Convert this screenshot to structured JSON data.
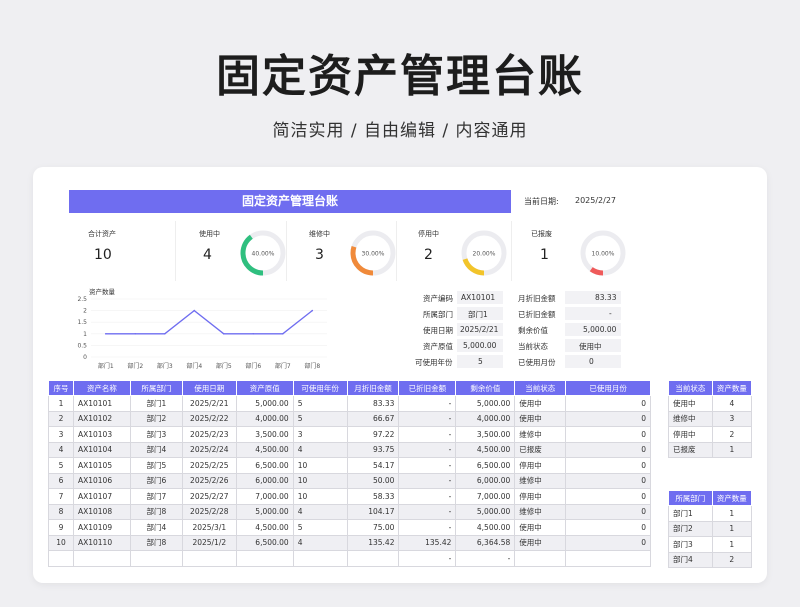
{
  "hero": {
    "title": "固定资产管理台账",
    "subtitle": "简洁实用 / 自由编辑 / 内容通用"
  },
  "sheet": {
    "title": "固定资产管理台账",
    "date_label": "当前日期:",
    "date_value": "2025/2/27"
  },
  "kpis": [
    {
      "label": "合计资产",
      "value": "10"
    },
    {
      "label": "使用中",
      "value": "4",
      "pct_label": "40.00%",
      "pct": 0.4,
      "color": "#2fbf7f"
    },
    {
      "label": "维修中",
      "value": "3",
      "pct_label": "30.00%",
      "pct": 0.3,
      "color": "#f08a3a"
    },
    {
      "label": "停用中",
      "value": "2",
      "pct_label": "20.00%",
      "pct": 0.2,
      "color": "#f2c42a"
    },
    {
      "label": "已报废",
      "value": "1",
      "pct_label": "10.00%",
      "pct": 0.1,
      "color": "#ef5a5a"
    }
  ],
  "chart_data": {
    "type": "line",
    "title": "资产数量",
    "categories": [
      "部门1",
      "部门2",
      "部门3",
      "部门4",
      "部门5",
      "部门6",
      "部门7",
      "部门8"
    ],
    "values": [
      1,
      1,
      1,
      2,
      1,
      1,
      1,
      2
    ],
    "ylim": [
      0,
      2.5
    ],
    "yticks": [
      "0",
      "0.5",
      "1",
      "1.5",
      "2",
      "2.5"
    ],
    "color": "#6f6df0"
  },
  "info": {
    "asset_code_label": "资产编码",
    "asset_code": "AX10101",
    "dept_label": "所属部门",
    "dept": "部门1",
    "use_date_label": "使用日期",
    "use_date": "2025/2/21",
    "orig_value_label": "资产原值",
    "orig_value": "5,000.00",
    "years_label": "可使用年份",
    "years": "5",
    "monthly_dep_label": "月折旧金额",
    "monthly_dep": "83.33",
    "done_dep_label": "已折旧金额",
    "done_dep": "-",
    "remain_label": "剩余价值",
    "remain": "5,000.00",
    "status_label": "当前状态",
    "status": "使用中",
    "used_months_label": "已使用月份",
    "used_months": "0"
  },
  "table": {
    "headers": [
      "序号",
      "资产名称",
      "所属部门",
      "使用日期",
      "资产原值",
      "可使用年份",
      "月折旧金额",
      "已折旧金额",
      "剩余价值",
      "当前状态",
      "已使用月份"
    ],
    "rows": [
      [
        "1",
        "AX10101",
        "部门1",
        "2025/2/21",
        "5,000.00",
        "5",
        "83.33",
        "-",
        "5,000.00",
        "使用中",
        "0"
      ],
      [
        "2",
        "AX10102",
        "部门2",
        "2025/2/22",
        "4,000.00",
        "5",
        "66.67",
        "-",
        "4,000.00",
        "使用中",
        "0"
      ],
      [
        "3",
        "AX10103",
        "部门3",
        "2025/2/23",
        "3,500.00",
        "3",
        "97.22",
        "-",
        "3,500.00",
        "维修中",
        "0"
      ],
      [
        "4",
        "AX10104",
        "部门4",
        "2025/2/24",
        "4,500.00",
        "4",
        "93.75",
        "-",
        "4,500.00",
        "已报废",
        "0"
      ],
      [
        "5",
        "AX10105",
        "部门5",
        "2025/2/25",
        "6,500.00",
        "10",
        "54.17",
        "-",
        "6,500.00",
        "停用中",
        "0"
      ],
      [
        "6",
        "AX10106",
        "部门6",
        "2025/2/26",
        "6,000.00",
        "10",
        "50.00",
        "-",
        "6,000.00",
        "维修中",
        "0"
      ],
      [
        "7",
        "AX10107",
        "部门7",
        "2025/2/27",
        "7,000.00",
        "10",
        "58.33",
        "-",
        "7,000.00",
        "停用中",
        "0"
      ],
      [
        "8",
        "AX10108",
        "部门8",
        "2025/2/28",
        "5,000.00",
        "4",
        "104.17",
        "-",
        "5,000.00",
        "维修中",
        "0"
      ],
      [
        "9",
        "AX10109",
        "部门4",
        "2025/3/1",
        "4,500.00",
        "5",
        "75.00",
        "-",
        "4,500.00",
        "使用中",
        "0"
      ],
      [
        "10",
        "AX10110",
        "部门8",
        "2025/1/2",
        "6,500.00",
        "4",
        "135.42",
        "135.42",
        "6,364.58",
        "使用中",
        "0"
      ],
      [
        "",
        "",
        "",
        "",
        "",
        "",
        "",
        "-",
        "-",
        "",
        ""
      ]
    ]
  },
  "status_table": {
    "headers": [
      "当前状态",
      "资产数量"
    ],
    "rows": [
      [
        "使用中",
        "4"
      ],
      [
        "维修中",
        "3"
      ],
      [
        "停用中",
        "2"
      ],
      [
        "已报废",
        "1"
      ]
    ]
  },
  "dept_table": {
    "headers": [
      "所属部门",
      "资产数量"
    ],
    "rows": [
      [
        "部门1",
        "1"
      ],
      [
        "部门2",
        "1"
      ],
      [
        "部门3",
        "1"
      ],
      [
        "部门4",
        "2"
      ]
    ]
  }
}
